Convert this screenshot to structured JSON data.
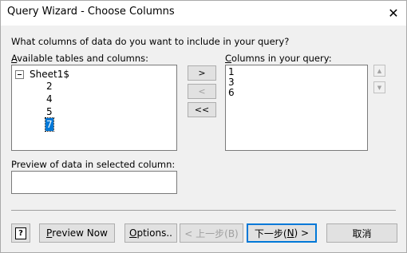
{
  "window": {
    "title": "Query Wizard - Choose Columns",
    "close_glyph": "✕"
  },
  "prompt": "What columns of data do you want to include in your query?",
  "available": {
    "label_pre": "",
    "label_accel": "A",
    "label_post": "vailable tables and columns:",
    "root": "Sheet1$",
    "children": [
      "2",
      "4",
      "5",
      "7"
    ],
    "selected_index": 3
  },
  "move_buttons": {
    "add": ">",
    "remove": "<",
    "remove_all": "<<"
  },
  "query_columns": {
    "label_accel": "C",
    "label_post": "olumns in your query:",
    "items": [
      "1",
      "3",
      "6"
    ]
  },
  "order_buttons": {
    "up": "▲",
    "down": "▼"
  },
  "preview": {
    "label": "Preview of data in selected column:",
    "value": ""
  },
  "footer": {
    "help_glyph": "?",
    "preview_now_pre": "P",
    "preview_now_post": "review Now",
    "options_pre": "",
    "options_accel": "O",
    "options_post": "ptions..",
    "back": "< 上一步(B)",
    "next_pre": "下一步(",
    "next_accel": "N",
    "next_post": ") >",
    "cancel": "取消"
  },
  "colors": {
    "selection": "#0078d7",
    "dialog_bg": "#f0f0f0"
  }
}
